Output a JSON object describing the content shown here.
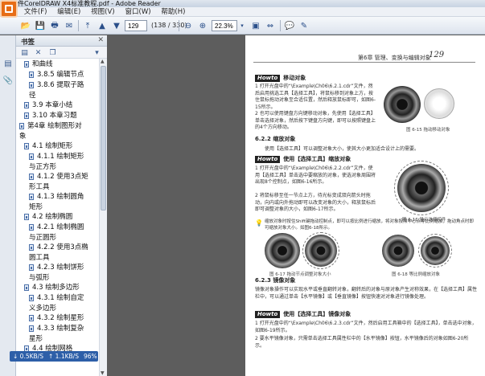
{
  "app": {
    "title": "文件CorelDRAW X4标准教程.pdf - Adobe Reader"
  },
  "menu": [
    "文件(F)",
    "编辑(E)",
    "视图(V)",
    "窗口(W)",
    "帮助(H)"
  ],
  "toolbar": {
    "page_current": "129",
    "page_info": "(138 / 330)",
    "zoom": "22.3%"
  },
  "bookmarks": {
    "title": "书签",
    "items": [
      {
        "text": "和曲线",
        "level": 1
      },
      {
        "text": "3.8.5  编辑节点",
        "level": 2
      },
      {
        "text": "3.8.6  提取子路",
        "level": 2
      },
      {
        "text": "径",
        "level": 2,
        "cont": true
      },
      {
        "text": "3.9  本章小结",
        "level": 1
      },
      {
        "text": "3.10  本章习题",
        "level": 1
      },
      {
        "text": "第4章  绘制图形对",
        "level": 0
      },
      {
        "text": "象",
        "level": 0,
        "cont": true
      },
      {
        "text": "4.1  绘制矩形",
        "level": 1
      },
      {
        "text": "4.1.1  绘制矩形",
        "level": 2
      },
      {
        "text": "与正方形",
        "level": 2,
        "cont": true
      },
      {
        "text": "4.1.2  使用3点矩",
        "level": 2
      },
      {
        "text": "形工具",
        "level": 2,
        "cont": true
      },
      {
        "text": "4.1.3  绘制圆角",
        "level": 2
      },
      {
        "text": "矩形",
        "level": 2,
        "cont": true
      },
      {
        "text": "4.2  绘制椭圆",
        "level": 1
      },
      {
        "text": "4.2.1  绘制椭圆",
        "level": 2
      },
      {
        "text": "与正圆形",
        "level": 2,
        "cont": true
      },
      {
        "text": "4.2.2  使用3点椭",
        "level": 2
      },
      {
        "text": "圆工具",
        "level": 2,
        "cont": true
      },
      {
        "text": "4.2.3  绘制饼形",
        "level": 2
      },
      {
        "text": "与弧形",
        "level": 2,
        "cont": true
      },
      {
        "text": "4.3  绘制多边形",
        "level": 1
      },
      {
        "text": "4.3.1  绘制自定",
        "level": 2
      },
      {
        "text": "义多边形",
        "level": 2,
        "cont": true
      },
      {
        "text": "4.3.2  绘制星形",
        "level": 2
      },
      {
        "text": "4.3.3  绘制复杂",
        "level": 2
      },
      {
        "text": "星形",
        "level": 2,
        "cont": true
      },
      {
        "text": "4.4  绘制网格",
        "level": 1
      }
    ]
  },
  "netspeed": {
    "down": "0.5KB/S",
    "up": "1.1KB/S",
    "percent": "96%"
  },
  "document": {
    "header": "第6章  管理、变换与编辑对象",
    "page_number": "129",
    "howto1": {
      "tag": "Howto",
      "text": "移动对象"
    },
    "p1": "1  打开光盘中的“\\Example\\Ch06\\6.2.1.cdr”文件，然后启用挑选工具【选择工具】，将鼠标移到对象上方，按住鼠标拖动对象至合适位置，然后释放鼠标即可，如图6-15所示。",
    "p2": "2  也可以使用键盘方向键移动对象，先使用【选择工具】单击选择对象，然后按下键盘方向键，即可以按照键盘上的4个方向移动。",
    "cap1": "图 6-15  拖动移动对象",
    "s622": "6.2.2  缩放对象",
    "p3": "使用【选择工具】可以调整对象大小，使其大小更加适合设计上的需要。",
    "howto2": {
      "tag": "Howto",
      "text": "使用【选择工具】缩放对象"
    },
    "p4": "1  打开光盘中的“\\Example\\Ch06\\6.2.2.cdr”文件，使用【选择工具】单击选中要缩放的对象，使选对象周围将出现8个控制点，如图6-16所示。",
    "cap2": "图 6-16  显示选择控件",
    "p5": "2  将鼠标移至任一节点上方，待光标变成双向箭头时拖动，向内或向外拖动即可以改变对象的大小，释放鼠标后即可调整对象的大小，如图6-17所示。",
    "note": "缩放对象时按住Shift键拖动控制点，即可以按比例进行缩放，将对象按照中心点等比例缩放，拖动角点时即可缩放对象大小。如图6-18所示。",
    "cap3": "图 6-17  拖动节点调整对象大小",
    "cap4": "图 6-18  等比例缩放对象",
    "s623": "6.2.3  镜像对象",
    "p6": "镜像对象操作可以实现水平或垂直翻转对象，翻转后的对象与原对象产生对称效果，在【选择工具】属性栏中，可以通过单击【水平镜像】或【垂直镜像】按钮快速对对象进行镜像处理。",
    "howto3": {
      "tag": "Howto",
      "text": "使用【选择工具】镜像对象"
    },
    "p7": "1  打开光盘中的“\\Example\\Ch06\\6.2.3.cdr”文件，然后启用工具箱中的【选择工具】，单击选中对象，如图6-19所示。",
    "p8": "2  要水平镜像对象，只需单击选择工具属性栏中的【水平镜像】按钮，水平镜像后的对象如图6-20所示。"
  }
}
